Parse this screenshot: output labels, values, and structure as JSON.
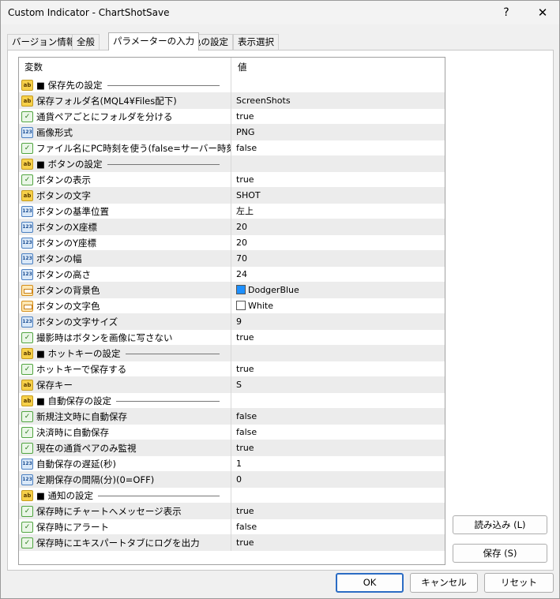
{
  "window": {
    "title": "Custom Indicator - ChartShotSave",
    "help_glyph": "?",
    "close_glyph": "✕"
  },
  "tabs": [
    {
      "label": "バージョン情報"
    },
    {
      "label": "全般"
    },
    {
      "label": "パラメーターの入力"
    },
    {
      "label": "色の設定"
    },
    {
      "label": "表示選択"
    }
  ],
  "grid": {
    "header_variable": "変数",
    "header_value": "値",
    "rows": [
      {
        "icon": "ab",
        "name": "■ 保存先の設定",
        "value": "",
        "separator": true
      },
      {
        "icon": "ab",
        "name": "保存フォルダ名(MQL4¥Files配下)",
        "value": "ScreenShots"
      },
      {
        "icon": "bool",
        "name": "通貨ペアごとにフォルダを分ける",
        "value": "true"
      },
      {
        "icon": "num",
        "name": "画像形式",
        "value": "PNG"
      },
      {
        "icon": "bool",
        "name": "ファイル名にPC時刻を使う(false=サーバー時刻)",
        "value": "false"
      },
      {
        "icon": "ab",
        "name": "■ ボタンの設定",
        "value": "",
        "separator": true
      },
      {
        "icon": "bool",
        "name": "ボタンの表示",
        "value": "true"
      },
      {
        "icon": "ab",
        "name": "ボタンの文字",
        "value": "SHOT"
      },
      {
        "icon": "num",
        "name": "ボタンの基準位置",
        "value": "左上"
      },
      {
        "icon": "num",
        "name": "ボタンのX座標",
        "value": "20"
      },
      {
        "icon": "num",
        "name": "ボタンのY座標",
        "value": "20"
      },
      {
        "icon": "num",
        "name": "ボタンの幅",
        "value": "70"
      },
      {
        "icon": "num",
        "name": "ボタンの高さ",
        "value": "24"
      },
      {
        "icon": "color",
        "name": "ボタンの背景色",
        "value": "DodgerBlue",
        "swatch": "#1e90ff"
      },
      {
        "icon": "color",
        "name": "ボタンの文字色",
        "value": "White",
        "swatch": "#ffffff"
      },
      {
        "icon": "num",
        "name": "ボタンの文字サイズ",
        "value": "9"
      },
      {
        "icon": "bool",
        "name": "撮影時はボタンを画像に写さない",
        "value": "true"
      },
      {
        "icon": "ab",
        "name": "■ ホットキーの設定",
        "value": "",
        "separator": true
      },
      {
        "icon": "bool",
        "name": "ホットキーで保存する",
        "value": "true"
      },
      {
        "icon": "ab",
        "name": "保存キー",
        "value": "S"
      },
      {
        "icon": "ab",
        "name": "■ 自動保存の設定",
        "value": "",
        "separator": true
      },
      {
        "icon": "bool",
        "name": "新規注文時に自動保存",
        "value": "false"
      },
      {
        "icon": "bool",
        "name": "決済時に自動保存",
        "value": "false"
      },
      {
        "icon": "bool",
        "name": "現在の通貨ペアのみ監視",
        "value": "true"
      },
      {
        "icon": "num",
        "name": "自動保存の遅延(秒)",
        "value": "1"
      },
      {
        "icon": "num",
        "name": "定期保存の間隔(分)(0=OFF)",
        "value": "0"
      },
      {
        "icon": "ab",
        "name": "■ 通知の設定",
        "value": "",
        "separator": true
      },
      {
        "icon": "bool",
        "name": "保存時にチャートへメッセージ表示",
        "value": "true"
      },
      {
        "icon": "bool",
        "name": "保存時にアラート",
        "value": "false"
      },
      {
        "icon": "bool",
        "name": "保存時にエキスパートタブにログを出力",
        "value": "true"
      }
    ]
  },
  "side_buttons": {
    "load": "読み込み (L)",
    "save": "保存 (S)"
  },
  "footer_buttons": {
    "ok": "OK",
    "cancel": "キャンセル",
    "reset": "リセット"
  },
  "icon_labels": {
    "ab": "ab",
    "bool": "✓",
    "num": "123"
  }
}
